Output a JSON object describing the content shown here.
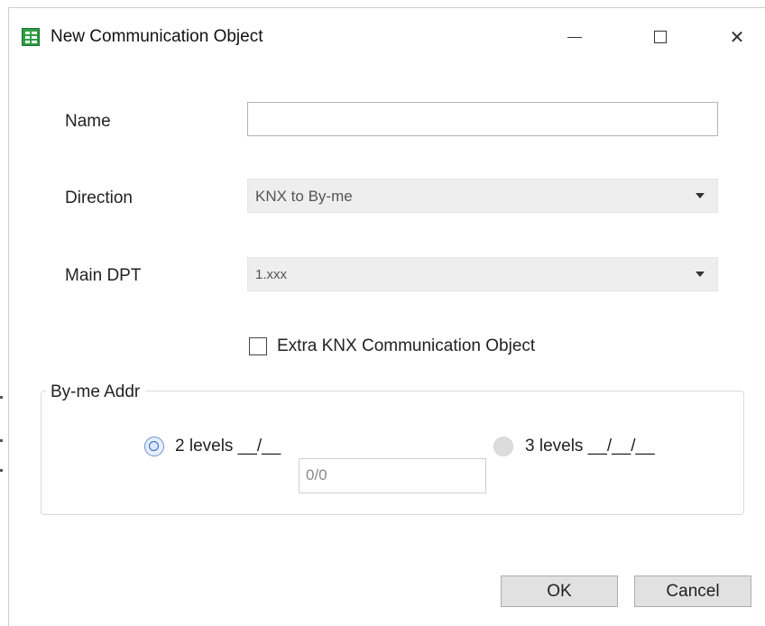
{
  "window": {
    "title": "New Communication Object",
    "controls": {
      "minimize": "—",
      "maximize": "☐",
      "close": "✕"
    }
  },
  "form": {
    "name": {
      "label": "Name",
      "value": "",
      "placeholder": ""
    },
    "direction": {
      "label": "Direction",
      "selected": "KNX to By-me"
    },
    "main_dpt": {
      "label": "Main DPT",
      "selected": "1.xxx"
    },
    "extra_object": {
      "label": "Extra KNX Communication Object",
      "checked": false
    }
  },
  "byme_addr": {
    "legend": "By-me Addr",
    "option_2_levels": {
      "label": "2 levels __/__",
      "checked": true
    },
    "option_3_levels": {
      "label": "3 levels __/__/__",
      "checked": false,
      "disabled": true
    },
    "address_value": "0/0"
  },
  "buttons": {
    "ok": "OK",
    "cancel": "Cancel"
  },
  "icons": {
    "app": "table-icon",
    "minimize": "minimize-icon",
    "maximize": "maximize-icon",
    "close": "close-icon"
  }
}
